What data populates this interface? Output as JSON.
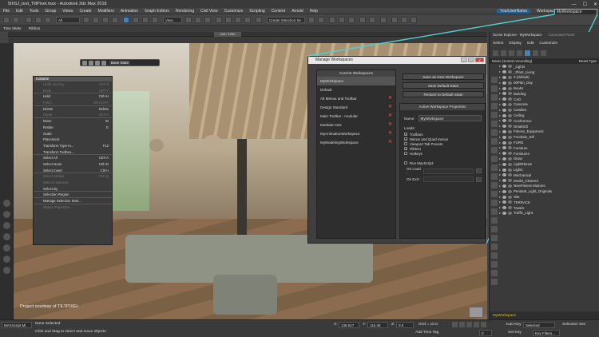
{
  "window": {
    "title": "5thSJ_test_TiltPixel.max - Autodesk 3ds Max 2018",
    "minimize": "—",
    "maximize": "☐",
    "close": "✕"
  },
  "menubar": {
    "items": [
      "File",
      "Edit",
      "Tools",
      "Group",
      "Views",
      "Create",
      "Modifiers",
      "Animation",
      "Graph Editors",
      "Rendering",
      "Civil View",
      "Customize",
      "Scripting",
      "Content",
      "Arnold",
      "Help"
    ],
    "user": "YourUserName",
    "workspaces_label": "Workspaces:",
    "workspace_value": "MyWorkspace"
  },
  "toolbar": {
    "filter_dropdown": "All",
    "view_dropdown": "View",
    "selection_set": "Create Selection Se"
  },
  "ribbon": {
    "time_slider": "Time Slider",
    "ribbon": "Ribbon"
  },
  "timeline": {
    "frame": "448 / 1250"
  },
  "viewport": {
    "shading": "Base State",
    "credit": "Project courtesy of TILTPIXEL"
  },
  "quadmenu": {
    "title": "Editable",
    "items": [
      {
        "label": "Undo Set Key",
        "shortcut": "Ctrl+Z",
        "disabled": true
      },
      {
        "label": "Redo",
        "shortcut": "Ctrl+Y",
        "disabled": true,
        "sep": true
      },
      {
        "label": "Hold",
        "shortcut": "Ctrl+H",
        "disabled": false
      },
      {
        "label": "Fetch",
        "shortcut": "Alt+Ctrl+F",
        "disabled": true,
        "sep": true
      },
      {
        "label": "Delete",
        "shortcut": "Delete",
        "disabled": false
      },
      {
        "label": "Clone",
        "shortcut": "Ctrl+V",
        "disabled": true,
        "sep": true
      },
      {
        "label": "Move",
        "shortcut": "W",
        "disabled": false
      },
      {
        "label": "Rotate",
        "shortcut": "E",
        "disabled": false
      },
      {
        "label": "Scale",
        "shortcut": "",
        "disabled": false
      },
      {
        "label": "Placement",
        "shortcut": "",
        "disabled": false
      },
      {
        "label": "Transform Type-In...",
        "shortcut": "F12",
        "disabled": false
      },
      {
        "label": "Transform Toolbox...",
        "shortcut": "",
        "disabled": false,
        "sep": true
      },
      {
        "label": "Select All",
        "shortcut": "Ctrl+A",
        "disabled": false
      },
      {
        "label": "Select None",
        "shortcut": "Ctrl+D",
        "disabled": false
      },
      {
        "label": "Select Invert",
        "shortcut": "Ctrl+I",
        "disabled": false,
        "sep": true
      },
      {
        "label": "Select Similar",
        "shortcut": "Ctrl+Q",
        "disabled": true
      },
      {
        "label": "Select Instances",
        "shortcut": "",
        "disabled": true
      },
      {
        "label": "Select By",
        "shortcut": "",
        "disabled": false,
        "sep": true
      },
      {
        "label": "Selection Region",
        "shortcut": "",
        "disabled": false,
        "sep": true
      },
      {
        "label": "Manage Selection Sets...",
        "shortcut": "",
        "disabled": false,
        "sep": true
      },
      {
        "label": "Object Properties...",
        "shortcut": "",
        "disabled": true
      }
    ]
  },
  "dialog": {
    "title": "Manage Workspaces",
    "current_header": "Current Workspaces",
    "workspaces": [
      {
        "name": "MyWorkspace",
        "removable": false,
        "selected": true
      },
      {
        "name": "Default",
        "removable": false,
        "selected": false
      },
      {
        "name": "Alt Menus and Toolbar",
        "removable": true,
        "selected": false
      },
      {
        "name": "Design Standard",
        "removable": true,
        "selected": false
      },
      {
        "name": "Main Toolbar - modular",
        "removable": true,
        "selected": false
      },
      {
        "name": "Modular-mini",
        "removable": true,
        "selected": false
      },
      {
        "name": "MyAnimationWorkspace",
        "removable": true,
        "selected": false
      },
      {
        "name": "MyModelingWorkspace",
        "removable": true,
        "selected": false
      }
    ],
    "save_as_new": "Save as New Workspace",
    "save_default": "Save Default State",
    "restore_default": "Restore to Default State",
    "props_header": "Active Workspace Properties",
    "name_label": "Name:",
    "name_value": "MyWorkspace",
    "loads_label": "Loads:",
    "loads": [
      {
        "label": "Toolbars",
        "checked": true
      },
      {
        "label": "Menus and Quad menus",
        "checked": true
      },
      {
        "label": "Viewport Tab Presets",
        "checked": false
      },
      {
        "label": "Ribbon",
        "checked": true
      },
      {
        "label": "Hotkeys",
        "checked": false
      }
    ],
    "run_maxscript": "Run MaxScript:",
    "on_load": "On Load :",
    "on_exit": "On Exit :"
  },
  "scene_explorer": {
    "title": "Scene Explorer - MyWorkspace",
    "tab2": "Command Panel",
    "menu": [
      "Select",
      "Display",
      "Edit",
      "Customize"
    ],
    "column": "Name (Sorted Ascending)",
    "reset": "Reset Type",
    "rows": [
      "_Lights",
      "_Plant_Living",
      "0 (default)",
      "00Plan_Day",
      "Books",
      "Building",
      "CAD",
      "Cameras",
      "Candles",
      "Ceiling",
      "Conference",
      "Details02",
      "Fitness_Equipment",
      "Fountain_Stll",
      "FURN",
      "Furniture",
      "Furnitures",
      "Glass",
      "LightRlense",
      "Lights",
      "Mechanical",
      "Model_Cleaned",
      "NewFitness Multons",
      "Pendant_Light_Originals",
      "Site",
      "TERRACE",
      "Towels",
      "Traffic_Light"
    ],
    "footer": "MyWorkspace"
  },
  "status": {
    "script_box": "MAXScript Mi.",
    "line1": "None Selected",
    "line2": "Click and drag to select and move objects",
    "x_label": "X:",
    "x_value": "136.517",
    "y_label": "Y:",
    "y_value": "116.46",
    "z_label": "Z:",
    "z_value": "0.0",
    "grid": "Grid = 10.0",
    "add_time_tag": "Add Time Tag",
    "auto_key": "Auto Key",
    "selected": "Selected",
    "set_key": "Set Key",
    "key_filters": "Key Filters...",
    "frame": "0",
    "selection_set": "Selection Set:"
  },
  "colors": {
    "accent": "#3d84c7",
    "callout": "#4fd0d0",
    "remove": "#e04040"
  }
}
